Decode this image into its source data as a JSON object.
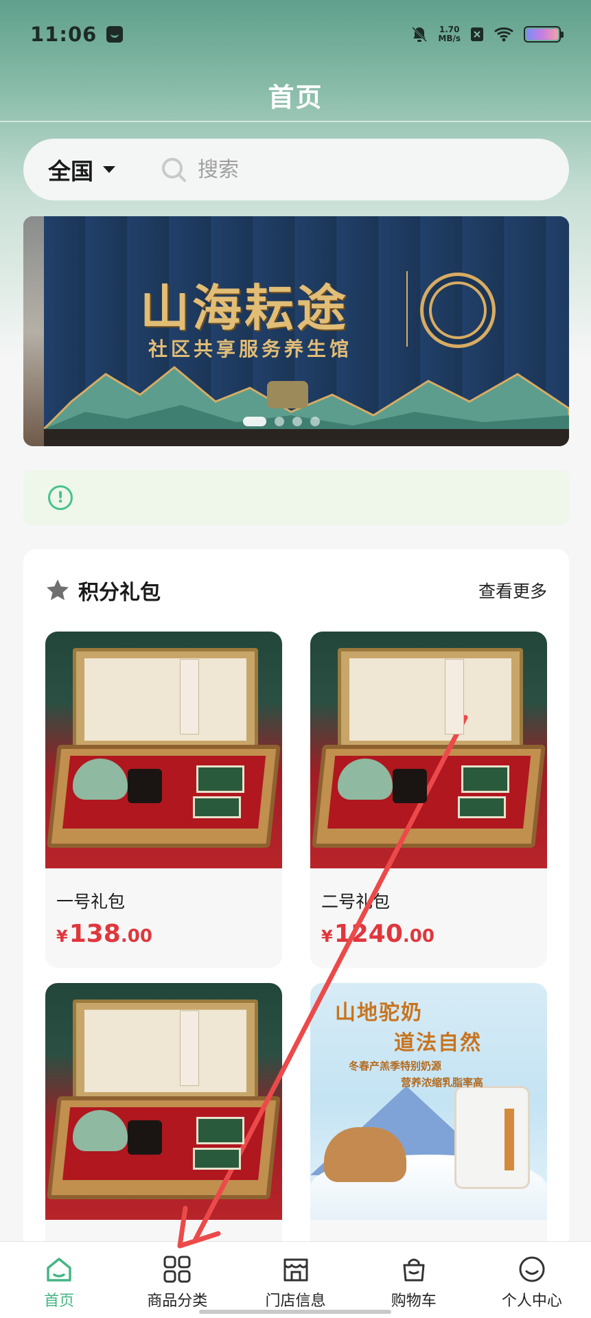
{
  "status_bar": {
    "time": "11:06",
    "speed_value": "1.70",
    "speed_unit": "MB/s"
  },
  "header": {
    "title": "首页"
  },
  "search": {
    "region": "全国",
    "placeholder": "搜索"
  },
  "banner": {
    "title": "山海耘途",
    "subtitle": "社区共享服务养生馆",
    "slide_count": 4,
    "active_slide": 1
  },
  "notice": {
    "text": ""
  },
  "points_section": {
    "title": "积分礼包",
    "more_label": "查看更多",
    "products": [
      {
        "name": "一号礼包",
        "currency": "¥",
        "price_int": "138",
        "price_dec": ".00",
        "image": "gift-box"
      },
      {
        "name": "二号礼包",
        "currency": "¥",
        "price_int": "1240",
        "price_dec": ".00",
        "image": "gift-box"
      },
      {
        "name": "",
        "currency": "",
        "price_int": "",
        "price_dec": "",
        "image": "gift-box"
      },
      {
        "name": "",
        "currency": "",
        "price_int": "",
        "price_dec": "",
        "image": "camel-milk",
        "image_text": {
          "line1": "山地驼奶",
          "line2": "道法自然",
          "line3": "冬春产羔季特别奶源",
          "line4": "营养浓缩乳脂率高"
        }
      }
    ]
  },
  "tabbar": {
    "active": "home",
    "tabs": [
      {
        "key": "home",
        "label": "首页",
        "icon": "home-icon"
      },
      {
        "key": "category",
        "label": "商品分类",
        "icon": "grid-icon"
      },
      {
        "key": "store",
        "label": "门店信息",
        "icon": "store-icon"
      },
      {
        "key": "cart",
        "label": "购物车",
        "icon": "bag-icon"
      },
      {
        "key": "profile",
        "label": "个人中心",
        "icon": "smile-icon"
      }
    ]
  },
  "colors": {
    "accent": "#44b583",
    "price": "#e0373d",
    "header_gradient_top": "#5fa08c",
    "annotation_arrow": "#ec4a4a"
  }
}
